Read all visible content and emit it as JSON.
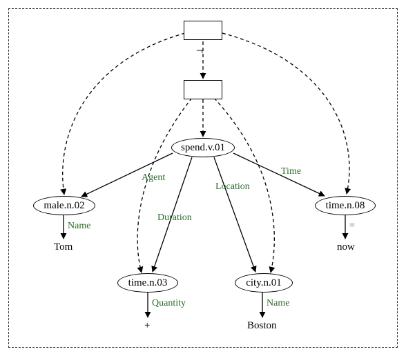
{
  "chart_data": {
    "type": "graph",
    "description": "Semantic graph (DRS-like) with a negation box scoping a proposition box containing a 'spend' event with Agent/Duration/Location/Time roles.",
    "nodes": [
      {
        "id": "neg-box",
        "kind": "box",
        "op": "¬",
        "contains": "prop-box"
      },
      {
        "id": "prop-box",
        "kind": "box",
        "contains": "spend"
      },
      {
        "id": "spend",
        "kind": "concept",
        "label": "spend.v.01"
      },
      {
        "id": "male",
        "kind": "concept",
        "label": "male.n.02",
        "attrs": {
          "Name": "Tom"
        }
      },
      {
        "id": "time03",
        "kind": "concept",
        "label": "time.n.03",
        "attrs": {
          "Quantity": "+"
        }
      },
      {
        "id": "city",
        "kind": "concept",
        "label": "city.n.01",
        "attrs": {
          "Name": "Boston"
        }
      },
      {
        "id": "time08",
        "kind": "concept",
        "label": "time.n.08",
        "attrs": {
          "=": "now"
        }
      }
    ],
    "edges": [
      {
        "from": "neg-box",
        "to": "prop-box",
        "style": "dashed",
        "label": "¬"
      },
      {
        "from": "prop-box",
        "to": "spend",
        "style": "dashed"
      },
      {
        "from": "neg-box",
        "to": "male",
        "style": "dashed"
      },
      {
        "from": "neg-box",
        "to": "time08",
        "style": "dashed"
      },
      {
        "from": "prop-box",
        "to": "time03",
        "style": "dashed"
      },
      {
        "from": "prop-box",
        "to": "city",
        "style": "dashed"
      },
      {
        "from": "spend",
        "to": "male",
        "style": "solid",
        "label": "Agent"
      },
      {
        "from": "spend",
        "to": "time03",
        "style": "solid",
        "label": "Duration"
      },
      {
        "from": "spend",
        "to": "city",
        "style": "solid",
        "label": "Location"
      },
      {
        "from": "spend",
        "to": "time08",
        "style": "solid",
        "label": "Time"
      }
    ]
  },
  "nodes": {
    "spend": "spend.v.01",
    "male": "male.n.02",
    "time03": "time.n.03",
    "city": "city.n.01",
    "time08": "time.n.08"
  },
  "leaves": {
    "tom": "Tom",
    "plus": "+",
    "boston": "Boston",
    "now": "now"
  },
  "labels": {
    "neg": "¬",
    "agent": "Agent",
    "duration": "Duration",
    "location": "Location",
    "time": "Time",
    "name1": "Name",
    "name2": "Name",
    "quantity": "Quantity",
    "eq": "="
  }
}
